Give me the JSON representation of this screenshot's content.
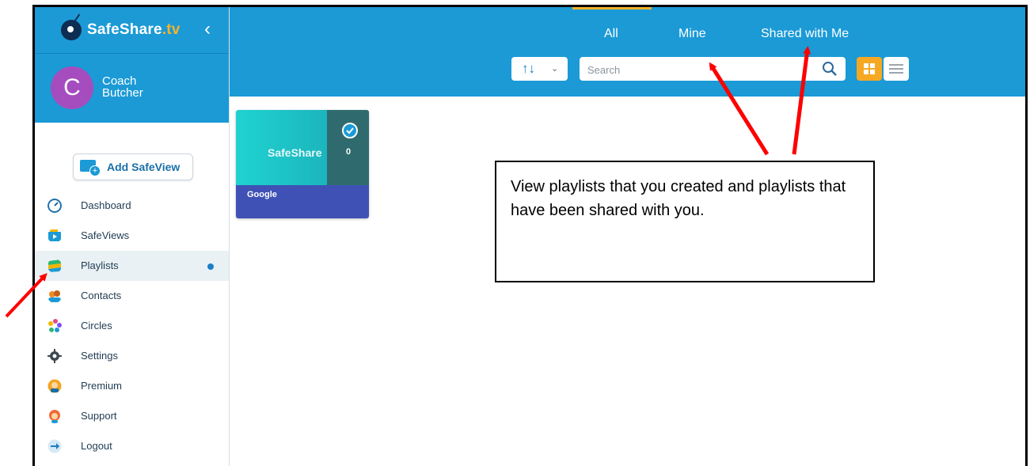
{
  "brand": {
    "name": "SafeShare",
    "suffix": ".tv",
    "collapse": "‹"
  },
  "user": {
    "initial": "C",
    "first": "Coach",
    "last": "Butcher"
  },
  "add_button": {
    "label": "Add SafeView"
  },
  "nav": [
    {
      "label": "Dashboard",
      "icon": "dashboard-icon",
      "color": "#1b6fa8"
    },
    {
      "label": "SafeViews",
      "icon": "safeviews-icon",
      "color": "#1b9ad6"
    },
    {
      "label": "Playlists",
      "icon": "playlists-icon",
      "color": "#f4b400",
      "active": true
    },
    {
      "label": "Contacts",
      "icon": "contacts-icon",
      "color": "#f08a24"
    },
    {
      "label": "Circles",
      "icon": "circles-icon",
      "color": "#e04a8a"
    },
    {
      "label": "Settings",
      "icon": "gear-icon",
      "color": "#3c4850"
    },
    {
      "label": "Premium",
      "icon": "premium-icon",
      "color": "#f4a623"
    },
    {
      "label": "Support",
      "icon": "support-icon",
      "color": "#f06a35"
    },
    {
      "label": "Logout",
      "icon": "logout-icon",
      "color": "#1b9ad6"
    }
  ],
  "tabs": {
    "all": "All",
    "mine": "Mine",
    "shared": "Shared with Me"
  },
  "search": {
    "placeholder": "Search"
  },
  "sort": {
    "arrows": "↑↓",
    "chevron": "⌄"
  },
  "card": {
    "logo": "SafeShare",
    "count": "0",
    "title": "Google"
  },
  "callout": {
    "text": "View playlists that you created and playlists that have been shared with you."
  },
  "colors": {
    "accent": "#1b9ad6",
    "highlight": "#f7a823",
    "arrow": "#ff0000"
  }
}
